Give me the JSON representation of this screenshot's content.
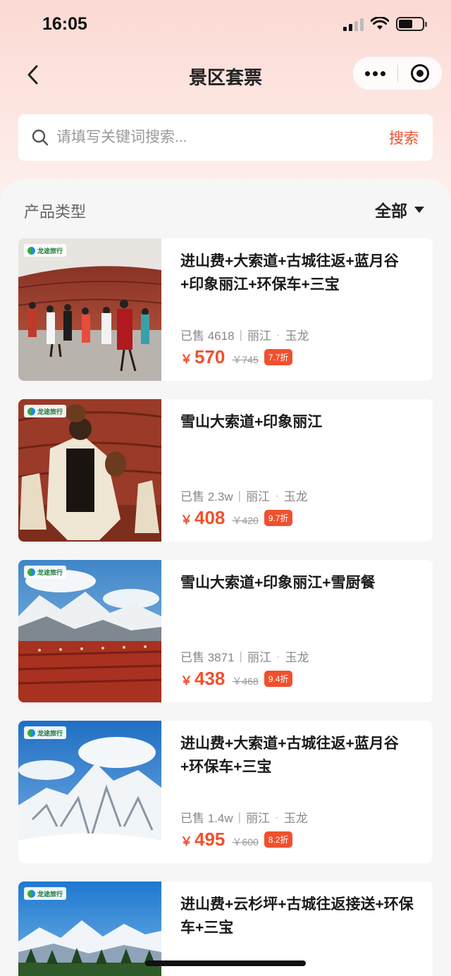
{
  "status_bar": {
    "time": "16:05"
  },
  "nav": {
    "title": "景区套票"
  },
  "search": {
    "placeholder": "请填写关键词搜索...",
    "button_label": "搜索"
  },
  "filter": {
    "label": "产品类型",
    "selected": "全部"
  },
  "brand_logo_text": "龙途旅行",
  "colors": {
    "accent": "#f0502d"
  },
  "products": [
    {
      "title": "进山费+大索道+古城往返+蓝月谷+印象丽江+环保车+三宝",
      "sold": "已售 4618",
      "city": "丽江",
      "district": "玉龙",
      "currency": "￥",
      "price": "570",
      "original_price": "￥745",
      "discount": "7.7折"
    },
    {
      "title": "雪山大索道+印象丽江",
      "sold": "已售 2.3w",
      "city": "丽江",
      "district": "玉龙",
      "currency": "￥",
      "price": "408",
      "original_price": "￥420",
      "discount": "9.7折"
    },
    {
      "title": "雪山大索道+印象丽江+雪厨餐",
      "sold": "已售 3871",
      "city": "丽江",
      "district": "玉龙",
      "currency": "￥",
      "price": "438",
      "original_price": "￥468",
      "discount": "9.4折"
    },
    {
      "title": "进山费+大索道+古城往返+蓝月谷+环保车+三宝",
      "sold": "已售 1.4w",
      "city": "丽江",
      "district": "玉龙",
      "currency": "￥",
      "price": "495",
      "original_price": "￥600",
      "discount": "8.2折"
    },
    {
      "title": "进山费+云杉坪+古城往返接送+环保车+三宝",
      "sold": "",
      "city": "",
      "district": "",
      "currency": "",
      "price": "",
      "original_price": "",
      "discount": ""
    }
  ]
}
